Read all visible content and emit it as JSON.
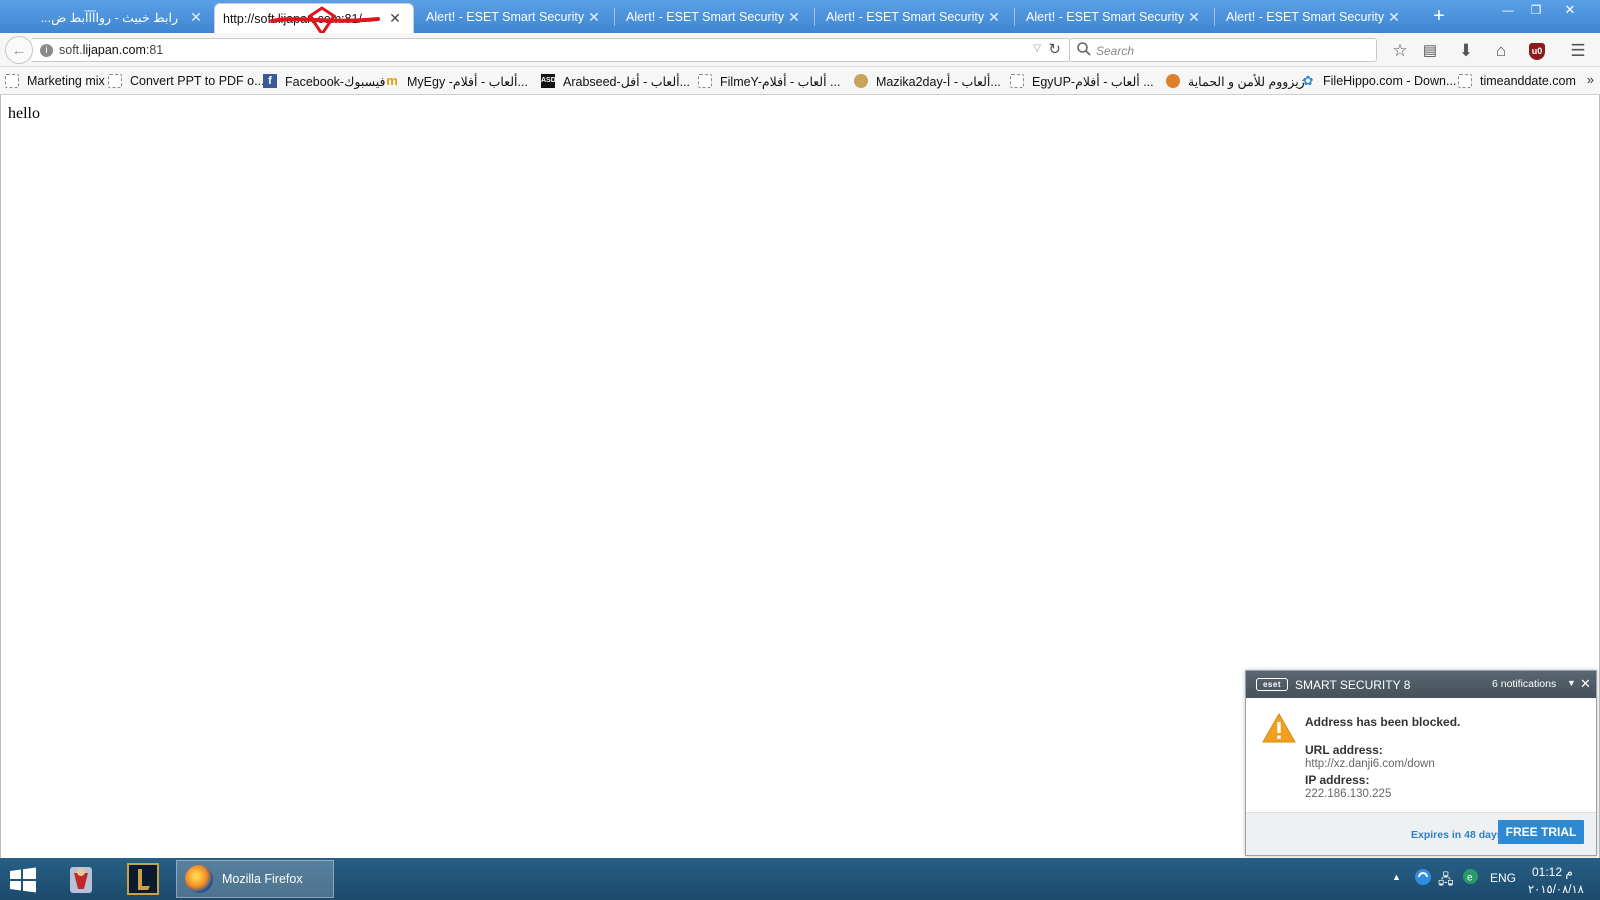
{
  "browser": {
    "tabs": [
      {
        "label": "رابط خبيث - رواآآآبط ض...",
        "active": false
      },
      {
        "label": "http://soft.lijapan.com:81/",
        "active": true
      },
      {
        "label": "Alert! - ESET Smart Security",
        "active": false
      },
      {
        "label": "Alert! - ESET Smart Security",
        "active": false
      },
      {
        "label": "Alert! - ESET Smart Security",
        "active": false
      },
      {
        "label": "Alert! - ESET Smart Security",
        "active": false
      },
      {
        "label": "Alert! - ESET Smart Security",
        "active": false
      }
    ],
    "url": {
      "prefix": "soft.",
      "host": "lijapan.com",
      "port": ":81"
    },
    "search_placeholder": "Search",
    "toolbar_icons": [
      "bookmark-star-icon",
      "reading-list-icon",
      "download-icon",
      "home-icon",
      "ublock-icon",
      "menu-icon"
    ],
    "ublock_label": "u0"
  },
  "bookmarks": [
    {
      "label": "Marketing mix",
      "icon": "blank"
    },
    {
      "label": "Convert PPT to PDF o...",
      "icon": "blank"
    },
    {
      "label": "Facebook-فيسبوك",
      "icon": "fb"
    },
    {
      "label": "MyEgy -ألعاب - أفلام...",
      "icon": "m"
    },
    {
      "label": "Arabseed-ألعاب - أفل...",
      "icon": "asd"
    },
    {
      "label": "FilmeY-ألعاب - أفلام ...",
      "icon": "blank"
    },
    {
      "label": "Mazika2day-ألعاب - أ...",
      "icon": "mz"
    },
    {
      "label": "EgyUP-ألعاب - أفلام ...",
      "icon": "blank"
    },
    {
      "label": "زيزووم للأمن و الحماية",
      "icon": "zz"
    },
    {
      "label": "FileHippo.com - Down...",
      "icon": "fh"
    },
    {
      "label": "timeanddate.com",
      "icon": "blank"
    }
  ],
  "page": {
    "text": "hello"
  },
  "eset": {
    "logo": "eset",
    "title": "SMART SECURITY 8",
    "notifications": "6 notifications",
    "message": "Address has been blocked.",
    "url_label": "URL address:",
    "url_value": "http://xz.danji6.com/down",
    "ip_label": "IP address:",
    "ip_value": "222.186.130.225",
    "expires": "Expires in 48 days",
    "trial_button": "FREE TRIAL",
    "accent_color": "#2d89d1"
  },
  "taskbar": {
    "firefox_label": "Mozilla Firefox",
    "language": "ENG",
    "time": "01:12 م",
    "date": "٢٠١٥/٠٨/١٨"
  }
}
